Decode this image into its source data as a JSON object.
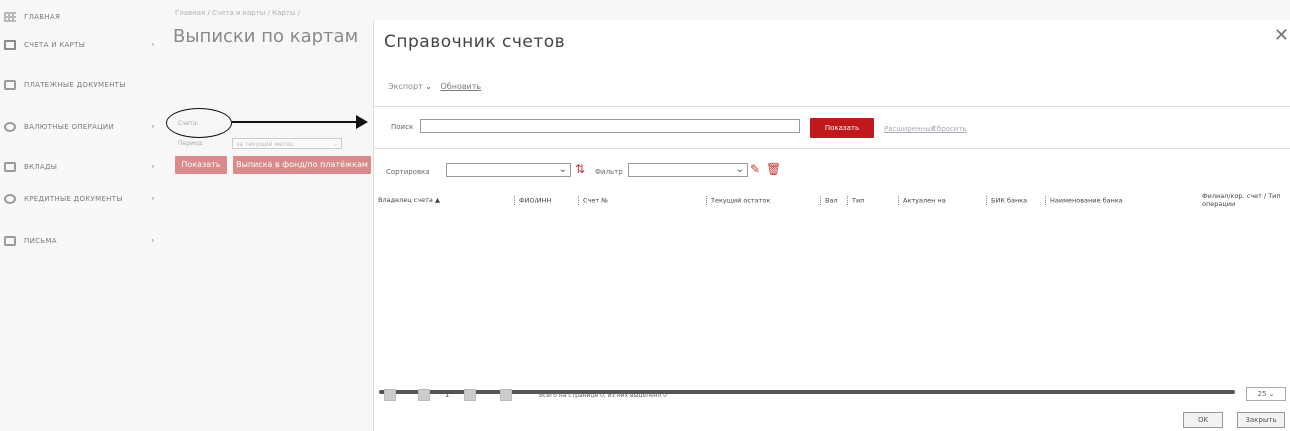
{
  "sidebar": {
    "items": [
      {
        "label": "Главная",
        "icon": "grid-icon"
      },
      {
        "label": "Счета и карты",
        "icon": "card-icon"
      },
      {
        "label": "Платежные документы",
        "icon": "document-icon"
      },
      {
        "label": "Валютные операции",
        "icon": "coin-icon"
      },
      {
        "label": "Вклады",
        "icon": "deposit-icon"
      },
      {
        "label": "Кредитные документы",
        "icon": "credit-icon"
      },
      {
        "label": "Письма",
        "icon": "letter-icon"
      }
    ]
  },
  "left_panel": {
    "breadcrumb": "Главная / Счета и карты / Карты /",
    "title": "Выписки по картам",
    "account_label": "Счета:",
    "period_label": "Период:",
    "period_value": "за текущий месяц",
    "button_show": "Показать",
    "button_statement": "Выписка в фонд/по платёжкам"
  },
  "dialog": {
    "title": "Справочник счетов",
    "export_label": "Экспорт",
    "refresh_label": "Обновить",
    "search_label": "Поиск",
    "search_value": "",
    "search_button": "Показать",
    "link_advanced": "Расширенный",
    "link_clear": "Сбросить",
    "sort_label": "Сортировка",
    "filter_label": "Фильтр",
    "columns": [
      "Владелец счета ▲",
      "ФИО/ИНН",
      "Счет №",
      "Текущий остаток",
      "Вал",
      "Тип",
      "Актуален на",
      "БИК банка",
      "Наименование банка",
      "Филиал/кор. счет / Тип операции"
    ],
    "pager_text": "Всего на странице 0, из них выделено 0",
    "page_number": "1",
    "page_size": "25",
    "ok_button": "OK",
    "cancel_button": "Закрыть"
  },
  "colors": {
    "accent": "#c0181d",
    "muted_accent": "#d98b8b"
  }
}
